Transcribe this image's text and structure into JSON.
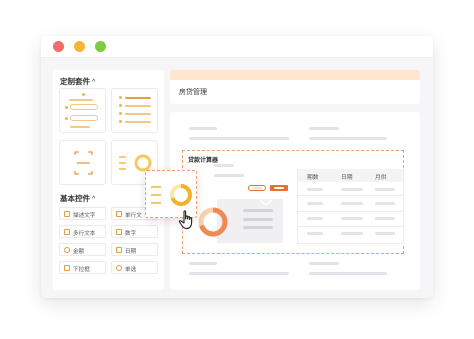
{
  "window": {
    "traffic_lights": [
      "#f26b6b",
      "#f7b53b",
      "#7ccc3f"
    ]
  },
  "left_panel": {
    "custom_kits_title": "定制套件",
    "basic_controls_title": "基本控件",
    "chevron": "^",
    "components": [
      {
        "label": "描述文字",
        "icon": "text-description-icon"
      },
      {
        "label": "单行文",
        "icon": "single-line-text-icon"
      },
      {
        "label": "多行文本",
        "icon": "multi-line-text-icon"
      },
      {
        "label": "数字",
        "icon": "number-icon"
      },
      {
        "label": "金额",
        "icon": "amount-icon"
      },
      {
        "label": "日期",
        "icon": "date-icon"
      },
      {
        "label": "下拉框",
        "icon": "dropdown-icon"
      },
      {
        "label": "单选",
        "icon": "radio-icon"
      }
    ]
  },
  "header": {
    "title": "房贷管理"
  },
  "calculator": {
    "title": "贷款计算器",
    "columns": [
      "期数",
      "日期",
      "月供"
    ]
  },
  "colors": {
    "accent": "#e8712a",
    "highlight": "#f4b02a",
    "light_accent": "#fde7cf"
  },
  "icons": {
    "cursor": "hand-pointer-icon",
    "scan": "scan-frame-icon",
    "ring": "donut-chart-icon"
  }
}
